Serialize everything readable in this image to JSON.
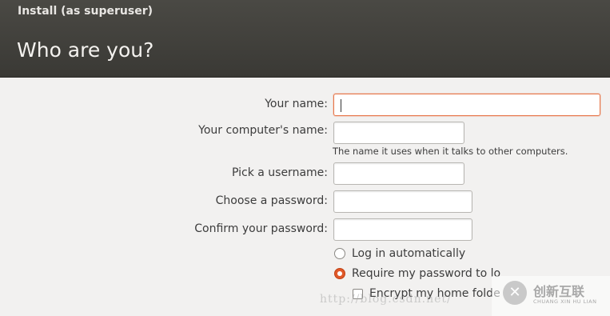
{
  "window": {
    "title": "Install (as superuser)"
  },
  "page": {
    "title": "Who are you?"
  },
  "form": {
    "name_label": "Your name:",
    "name_value": "",
    "computer_name_label": "Your computer's name:",
    "computer_name_value": "",
    "computer_name_hint": "The name it uses when it talks to other computers.",
    "username_label": "Pick a username:",
    "username_value": "",
    "password_label": "Choose a password:",
    "password_value": "",
    "confirm_label": "Confirm your password:",
    "confirm_value": "",
    "login_options": [
      {
        "label": "Log in automatically",
        "selected": false
      },
      {
        "label": "Require my password to lo",
        "selected": true
      }
    ],
    "encrypt_label": "Encrypt my home folde",
    "encrypt_checked": false
  },
  "watermark": {
    "url": "http://blog.csdn.net/",
    "brand": "创新互联",
    "brand_sub": "CHUANG XIN HU LIAN"
  },
  "colors": {
    "header": "#3c3b37",
    "accent": "#e0592a",
    "background": "#f2f1f0"
  }
}
